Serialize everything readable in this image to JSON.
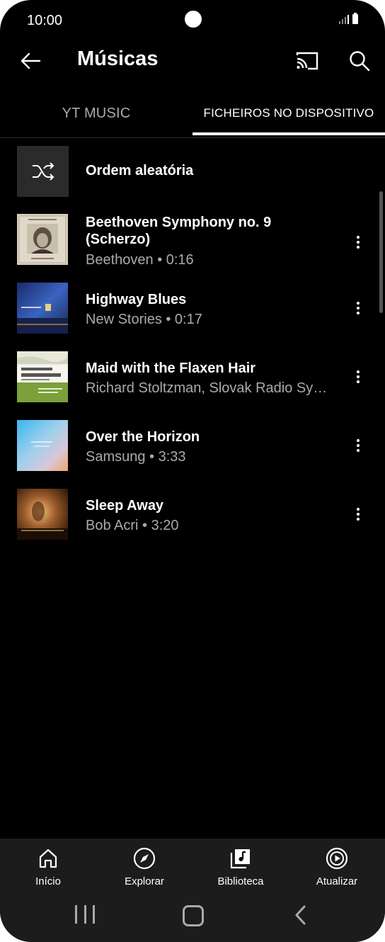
{
  "status_bar": {
    "time": "10:00"
  },
  "header": {
    "title": "Músicas"
  },
  "tabs": [
    {
      "label": "YT MUSIC",
      "selected": false
    },
    {
      "label": "FICHEIROS NO DISPOSITIVO",
      "selected": true
    }
  ],
  "shuffle": {
    "label": "Ordem aleatória"
  },
  "songs": [
    {
      "title": "Beethoven Symphony no. 9 (Scherzo)",
      "subtitle": "Beethoven • 0:16"
    },
    {
      "title": "Highway Blues",
      "subtitle": "New Stories • 0:17"
    },
    {
      "title": "Maid with the Flaxen Hair",
      "subtitle": "Richard Stoltzman, Slovak Radio Sy…"
    },
    {
      "title": "Over the Horizon",
      "subtitle": "Samsung • 3:33"
    },
    {
      "title": "Sleep Away",
      "subtitle": "Bob Acri • 3:20"
    }
  ],
  "bottom_nav": [
    {
      "label": "Início",
      "icon": "home-icon"
    },
    {
      "label": "Explorar",
      "icon": "compass-icon"
    },
    {
      "label": "Biblioteca",
      "icon": "library-icon",
      "selected": true
    },
    {
      "label": "Atualizar",
      "icon": "upgrade-icon"
    }
  ],
  "colors": {
    "background": "#000000",
    "nav_background": "#1c1c1c",
    "secondary_text": "#aaaaaa"
  }
}
